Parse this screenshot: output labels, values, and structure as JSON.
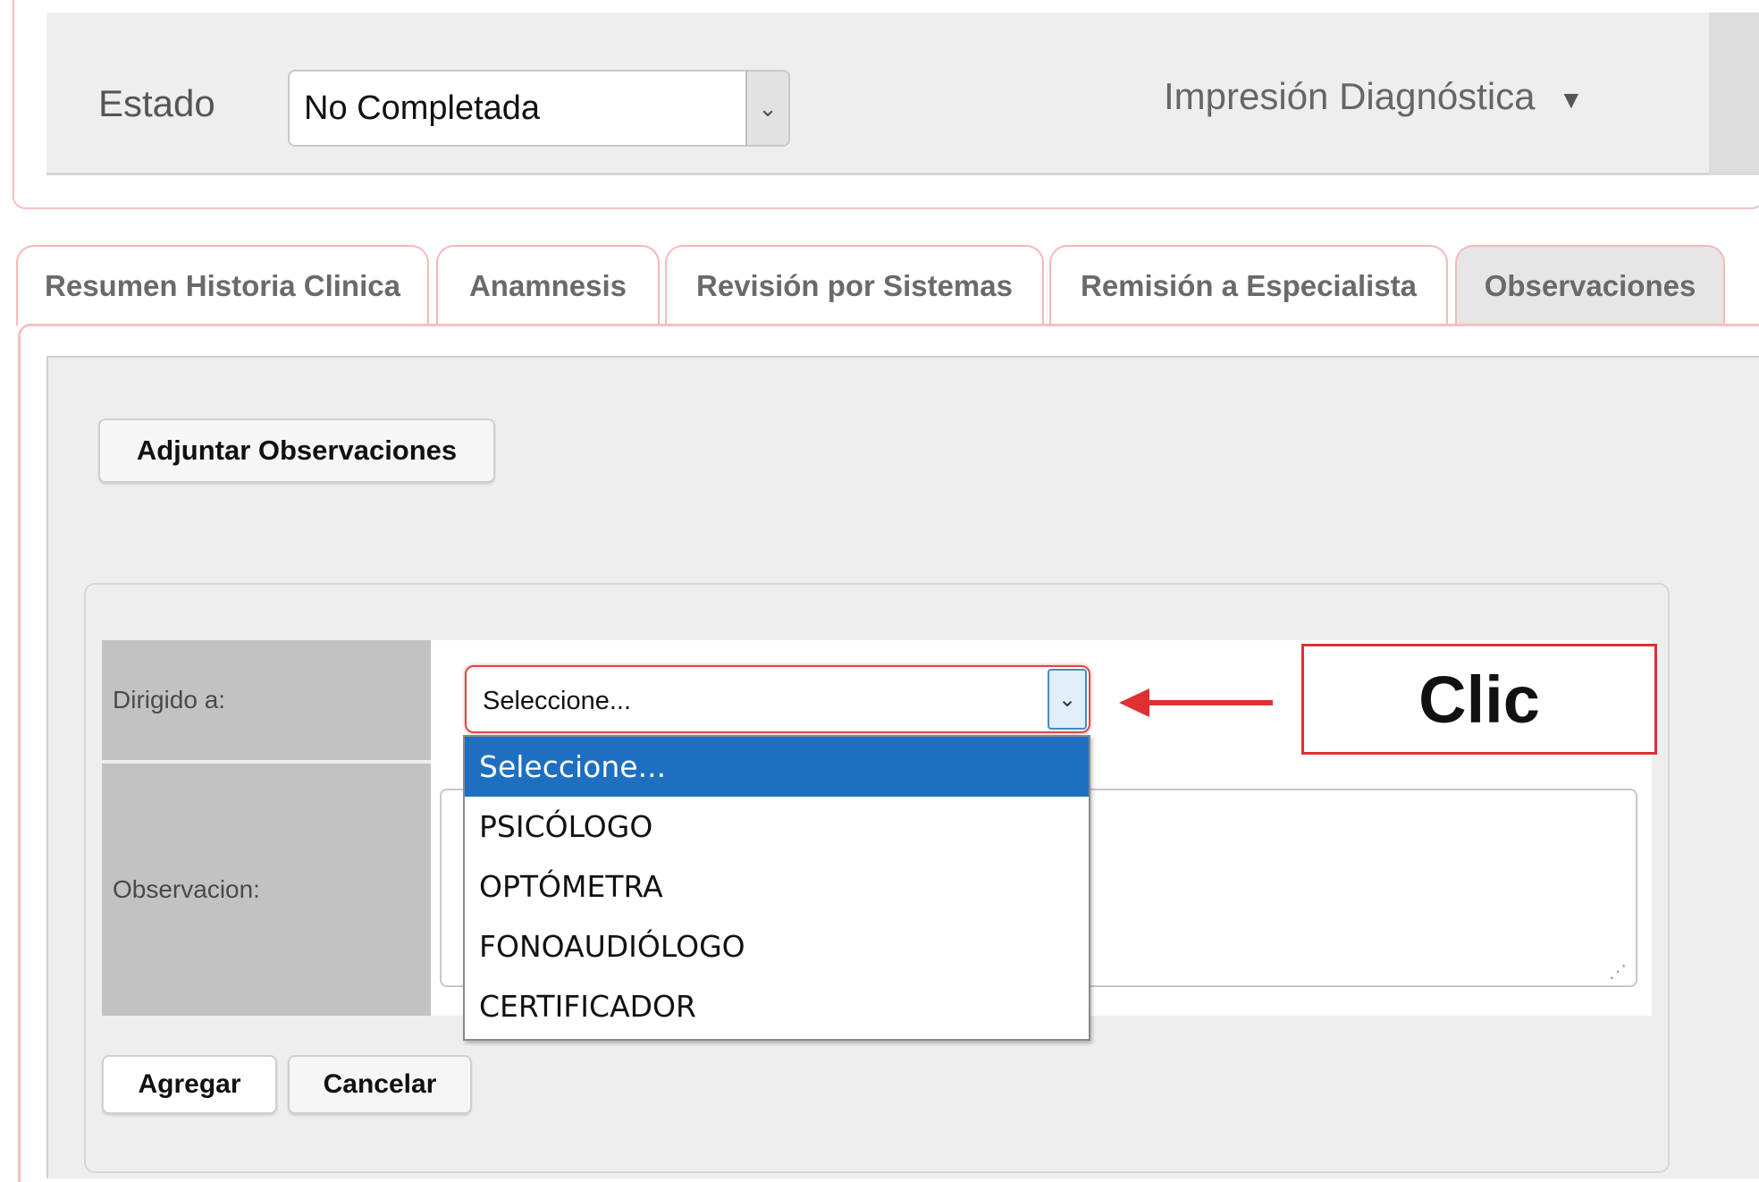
{
  "estado": {
    "label": "Estado",
    "selected": "No Completada"
  },
  "impresion": {
    "label": "Impresión Diagnóstica"
  },
  "tabs": [
    {
      "label": "Resumen Historia Clinica",
      "active": false
    },
    {
      "label": "Anamnesis",
      "active": false
    },
    {
      "label": "Revisión por Sistemas",
      "active": false
    },
    {
      "label": "Remisión a Especialista",
      "active": false
    },
    {
      "label": "Observaciones",
      "active": true
    }
  ],
  "actions": {
    "adjuntar_label": "Adjuntar Observaciones",
    "agregar_label": "Agregar",
    "cancelar_label": "Cancelar"
  },
  "form": {
    "dirigido_label": "Dirigido a:",
    "dirigido_selected": "Seleccione...",
    "observacion_label": "Observacion:"
  },
  "dropdown": {
    "options": [
      "Seleccione...",
      "PSICÓLOGO",
      "OPTÓMETRA",
      "FONOAUDIÓLOGO",
      "CERTIFICADOR"
    ],
    "highlighted_index": 0
  },
  "annotation": {
    "callout_text": "Clic",
    "color": "#e03030"
  },
  "colors": {
    "highlight": "#1e6fc0",
    "tab_border": "#f5b9b9"
  }
}
